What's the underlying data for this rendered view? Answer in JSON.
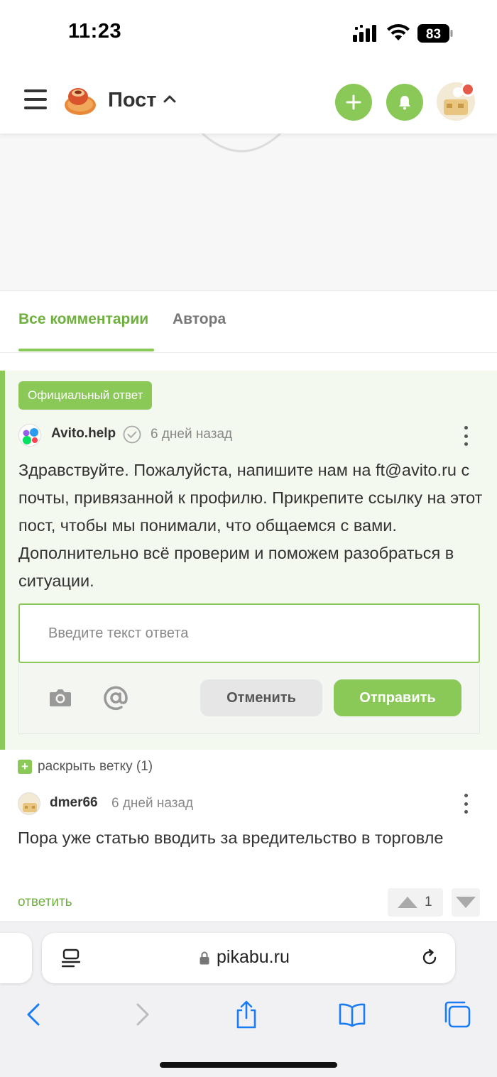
{
  "status_bar": {
    "time": "11:23",
    "battery": "83"
  },
  "header": {
    "title": "Пост",
    "accent_color": "#8ac858"
  },
  "tabs": [
    {
      "label": "Все комментарии",
      "active": true
    },
    {
      "label": "Автора",
      "active": false
    }
  ],
  "official_comment": {
    "badge": "Официальный ответ",
    "author": "Avito.help",
    "time": "6 дней назад",
    "text": "Здравствуйте. Пожалуйста, напишите нам на ft@avito.ru с почты, привязанной к профилю. Прикрепите ссылку на этот пост, чтобы мы понимали, что общаемся с вами. Дополнительно всё проверим и поможем разобраться в ситуации."
  },
  "reply_form": {
    "placeholder": "Введите текст ответа",
    "cancel_label": "Отменить",
    "send_label": "Отправить"
  },
  "expand_thread": {
    "label": "раскрыть ветку (1)"
  },
  "comment2": {
    "author": "dmer66",
    "time": "6 дней назад",
    "text": "Пора уже статью вводить за вредительство в торговле",
    "reply_label": "ответить",
    "votes": "1"
  },
  "browser": {
    "url": "pikabu.ru"
  }
}
